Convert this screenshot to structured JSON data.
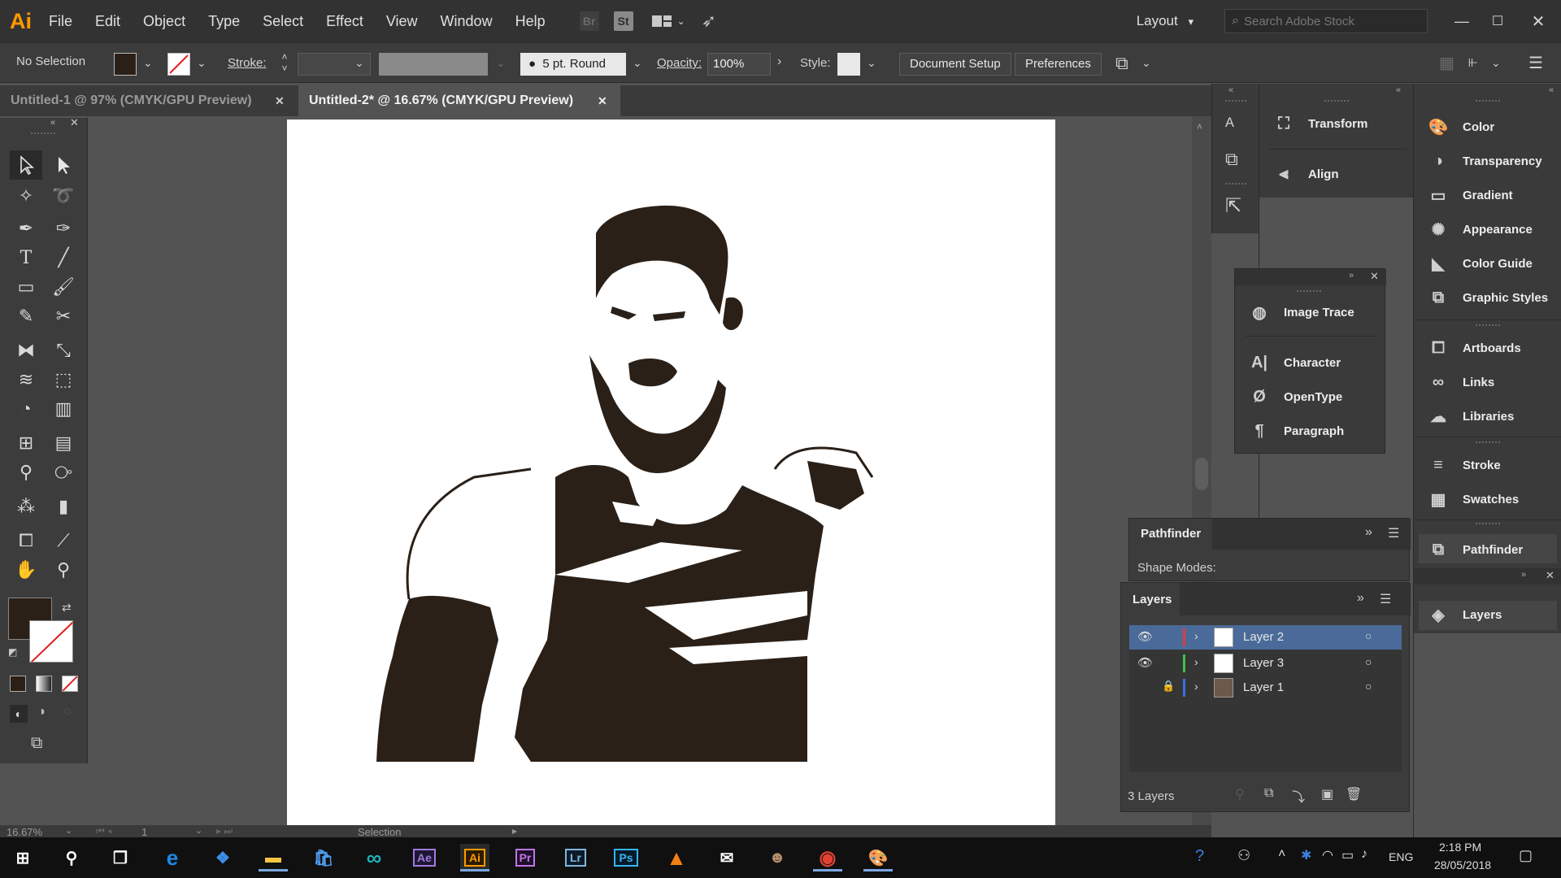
{
  "menu": {
    "logo": "Ai",
    "items": [
      "File",
      "Edit",
      "Object",
      "Type",
      "Select",
      "Effect",
      "View",
      "Window",
      "Help"
    ],
    "bridge_badge": "Br",
    "stock_badge": "St",
    "workspace": "Layout",
    "search_placeholder": "Search Adobe Stock"
  },
  "control": {
    "selection_status": "No Selection",
    "stroke_label": "Stroke:",
    "brush": "5 pt. Round",
    "opacity_label": "Opacity:",
    "opacity_value": "100%",
    "style_label": "Style:",
    "document_setup": "Document Setup",
    "preferences": "Preferences"
  },
  "tabs": [
    {
      "label": "Untitled-1 @ 97% (CMYK/GPU Preview)",
      "close": "✕"
    },
    {
      "label": "Untitled-2* @ 16.67% (CMYK/GPU Preview)",
      "close": "✕"
    }
  ],
  "status": {
    "zoom": "16.67%",
    "artboard": "1",
    "tool": "Selection"
  },
  "panels_col1": [
    {
      "label": "Transform",
      "icon": "transform-icon"
    },
    {
      "label": "Align",
      "icon": "align-icon"
    }
  ],
  "panels_float": [
    {
      "label": "Image Trace",
      "icon": "image-trace-icon"
    },
    {
      "label": "Character",
      "icon": "character-icon"
    },
    {
      "label": "OpenType",
      "icon": "opentype-icon"
    },
    {
      "label": "Paragraph",
      "icon": "paragraph-icon"
    }
  ],
  "panels_col2": [
    {
      "label": "Color",
      "icon": "color-icon"
    },
    {
      "label": "Transparency",
      "icon": "transparency-icon"
    },
    {
      "label": "Gradient",
      "icon": "gradient-icon"
    },
    {
      "label": "Appearance",
      "icon": "appearance-icon"
    },
    {
      "label": "Color Guide",
      "icon": "color-guide-icon"
    },
    {
      "label": "Graphic Styles",
      "icon": "graphic-styles-icon"
    },
    {
      "label": "Artboards",
      "icon": "artboards-icon"
    },
    {
      "label": "Links",
      "icon": "links-icon"
    },
    {
      "label": "Libraries",
      "icon": "libraries-icon"
    },
    {
      "label": "Stroke",
      "icon": "stroke-icon"
    },
    {
      "label": "Swatches",
      "icon": "swatches-icon"
    },
    {
      "label": "Pathfinder",
      "icon": "pathfinder-icon"
    },
    {
      "label": "Layers",
      "icon": "layers-icon"
    }
  ],
  "pathfinder": {
    "title": "Pathfinder",
    "shape_modes": "Shape Modes:"
  },
  "layers": {
    "title": "Layers",
    "count": "3 Layers",
    "rows": [
      {
        "name": "Layer 2",
        "color": "#e23b3b",
        "visible": true,
        "locked": false,
        "selected": true
      },
      {
        "name": "Layer 3",
        "color": "#3cc24a",
        "visible": true,
        "locked": false,
        "selected": false
      },
      {
        "name": "Layer 1",
        "color": "#3b6fe2",
        "visible": false,
        "locked": true,
        "selected": false
      }
    ]
  },
  "taskbar": {
    "time": "2:18 PM",
    "date": "28/05/2018",
    "lang": "ENG",
    "apps": [
      "Ae",
      "Ai",
      "Pr",
      "Lr",
      "Ps"
    ]
  },
  "colors": {
    "fill_swatch": "#2a2018",
    "accent_orange": "#ff9a00",
    "selection_blue": "#4a6b99"
  }
}
